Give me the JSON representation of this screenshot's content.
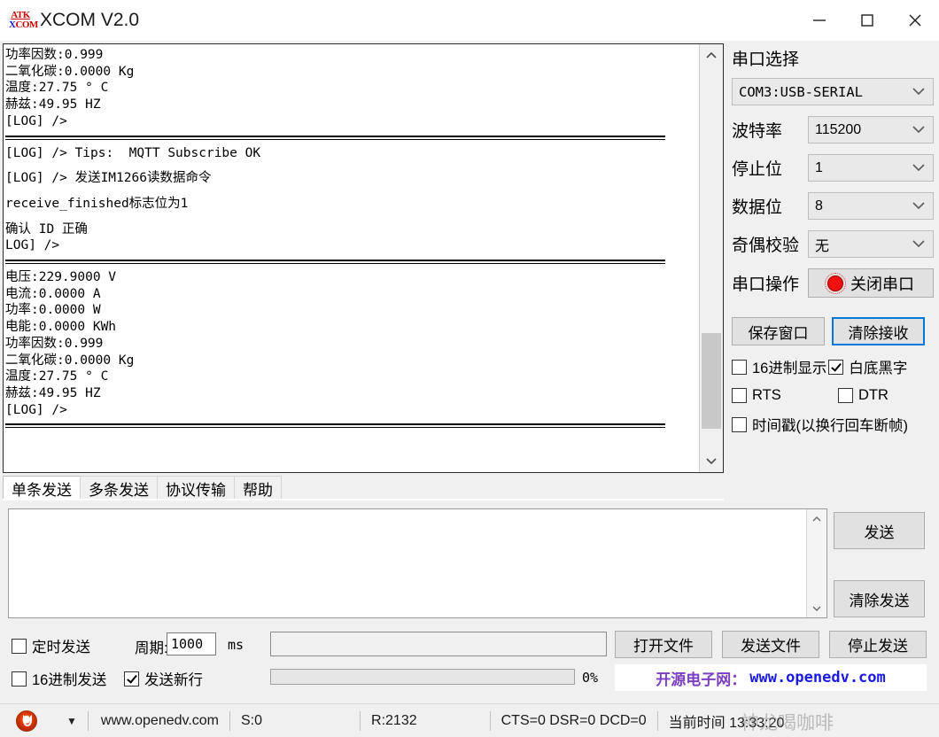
{
  "window": {
    "title": "XCOM V2.0",
    "icon_top": "ATK",
    "icon_bottom": "XCOM",
    "minimize_label": "Minimize",
    "maximize_label": "Maximize",
    "close_label": "Close"
  },
  "receive": {
    "blocks": [
      {
        "type": "lines",
        "lines": [
          "功率因数:0.999",
          "二氧化碳:0.0000 Kg",
          "温度:27.75 ° C",
          "赫兹:49.95 HZ",
          "[LOG] />"
        ]
      },
      {
        "type": "separator"
      },
      {
        "type": "lines",
        "lines": [
          "[LOG] /> Tips:  MQTT Subscribe OK"
        ]
      },
      {
        "type": "blank"
      },
      {
        "type": "lines",
        "lines": [
          "[LOG] /> 发送IM1266读数据命令"
        ]
      },
      {
        "type": "blank"
      },
      {
        "type": "lines",
        "lines": [
          "receive_finished标志位为1"
        ]
      },
      {
        "type": "blank"
      },
      {
        "type": "lines",
        "lines": [
          "确认 ID 正确",
          "LOG] />"
        ]
      },
      {
        "type": "separator"
      },
      {
        "type": "lines",
        "lines": [
          "电压:229.9000 V",
          "电流:0.0000 A",
          "功率:0.0000 W",
          "电能:0.0000 KWh",
          "功率因数:0.999",
          "二氧化碳:0.0000 Kg",
          "温度:27.75 ° C",
          "赫兹:49.95 HZ",
          "[LOG] />"
        ]
      },
      {
        "type": "separator"
      }
    ]
  },
  "tabs": [
    {
      "label": "单条发送",
      "active": true
    },
    {
      "label": "多条发送",
      "active": false
    },
    {
      "label": "协议传输",
      "active": false
    },
    {
      "label": "帮助",
      "active": false
    }
  ],
  "send": {
    "text": "",
    "send_button": "发送",
    "clear_send_button": "清除发送"
  },
  "options": {
    "timed_send_label": "定时发送",
    "timed_send_checked": false,
    "period_label": "周期:",
    "period_value": "1000",
    "period_unit": "ms",
    "hex_send_label": "16进制发送",
    "hex_send_checked": false,
    "newline_send_label": "发送新行",
    "newline_send_checked": true,
    "file_path": "",
    "progress_percent": "0%",
    "progress_value": 0,
    "open_file_button": "打开文件",
    "send_file_button": "发送文件",
    "stop_send_button": "停止发送"
  },
  "ad": {
    "cn_text": "开源电子网：",
    "url_text": "www.openedv.com"
  },
  "panel": {
    "port_title": "串口选择",
    "port_value": "COM3:USB-SERIAL",
    "rows": [
      {
        "label": "波特率",
        "value": "115200"
      },
      {
        "label": "停止位",
        "value": "1"
      },
      {
        "label": "数据位",
        "value": "8"
      },
      {
        "label": "奇偶校验",
        "value": "无"
      }
    ],
    "operation_label": "串口操作",
    "close_port_button": "关闭串口",
    "save_window_button": "保存窗口",
    "clear_receive_button": "清除接收",
    "checks": {
      "hex_display_label": "16进制显示",
      "hex_display_checked": false,
      "white_bg_label": "白底黑字",
      "white_bg_checked": true,
      "rts_label": "RTS",
      "rts_checked": false,
      "dtr_label": "DTR",
      "dtr_checked": false,
      "timestamp_label": "时间戳(以换行回车断帧)",
      "timestamp_checked": false
    }
  },
  "statusbar": {
    "url": "www.openedv.com",
    "sent": "S:0",
    "received": "R:2132",
    "modem": "CTS=0 DSR=0 DCD=0",
    "time_label": "当前时间 13:33:20",
    "watermark": "神龙喝咖啡"
  },
  "colors": {
    "accent": "#0078d7",
    "led_red": "#ef1111",
    "ad_purple": "#7b3fbf",
    "ad_blue": "#1a1ae0"
  }
}
